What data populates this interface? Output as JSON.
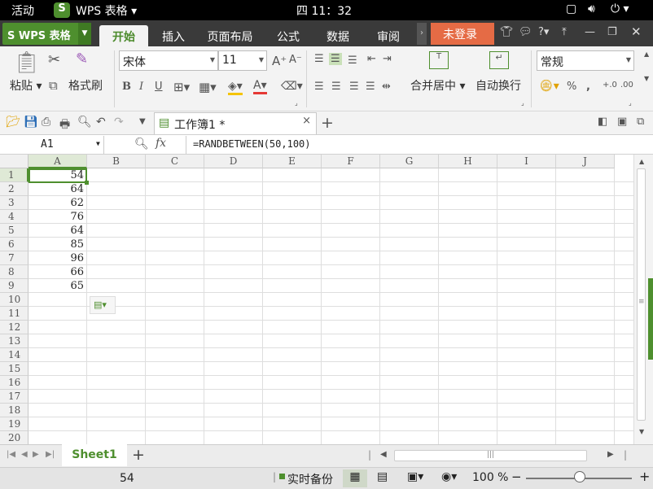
{
  "system": {
    "activities": "活动",
    "app_name": "WPS 表格",
    "clock": "四 11：32"
  },
  "title": {
    "wps_button": "WPS 表格",
    "login": "未登录"
  },
  "tabs": [
    "开始",
    "插入",
    "页面布局",
    "公式",
    "数据",
    "审阅"
  ],
  "ribbon": {
    "paste": "粘贴",
    "format_painter": "格式刷",
    "font_name": "宋体",
    "font_size": "11",
    "merge_center": "合并居中",
    "wrap_text": "自动换行",
    "number_format": "常规",
    "percent": "%",
    "comma": ","
  },
  "document": {
    "tab_title": "工作簿1 *"
  },
  "formula_bar": {
    "cell_ref": "A1",
    "fx": "fx",
    "formula": "=RANDBETWEEN(50,100)"
  },
  "grid": {
    "columns": [
      "A",
      "B",
      "C",
      "D",
      "E",
      "F",
      "G",
      "H",
      "I",
      "J"
    ],
    "rows": [
      "1",
      "2",
      "3",
      "4",
      "5",
      "6",
      "7",
      "8",
      "9",
      "10",
      "11",
      "12",
      "13",
      "14",
      "15",
      "16",
      "17",
      "18",
      "19",
      "20"
    ],
    "a_values": [
      "54",
      "64",
      "62",
      "76",
      "64",
      "85",
      "96",
      "66",
      "65"
    ]
  },
  "sheet": {
    "name": "Sheet1"
  },
  "status": {
    "cell_value": "54",
    "backup": "实时备份",
    "zoom": "100 %"
  },
  "colors": {
    "accent": "#4e8f2e",
    "login": "#e56b45"
  }
}
